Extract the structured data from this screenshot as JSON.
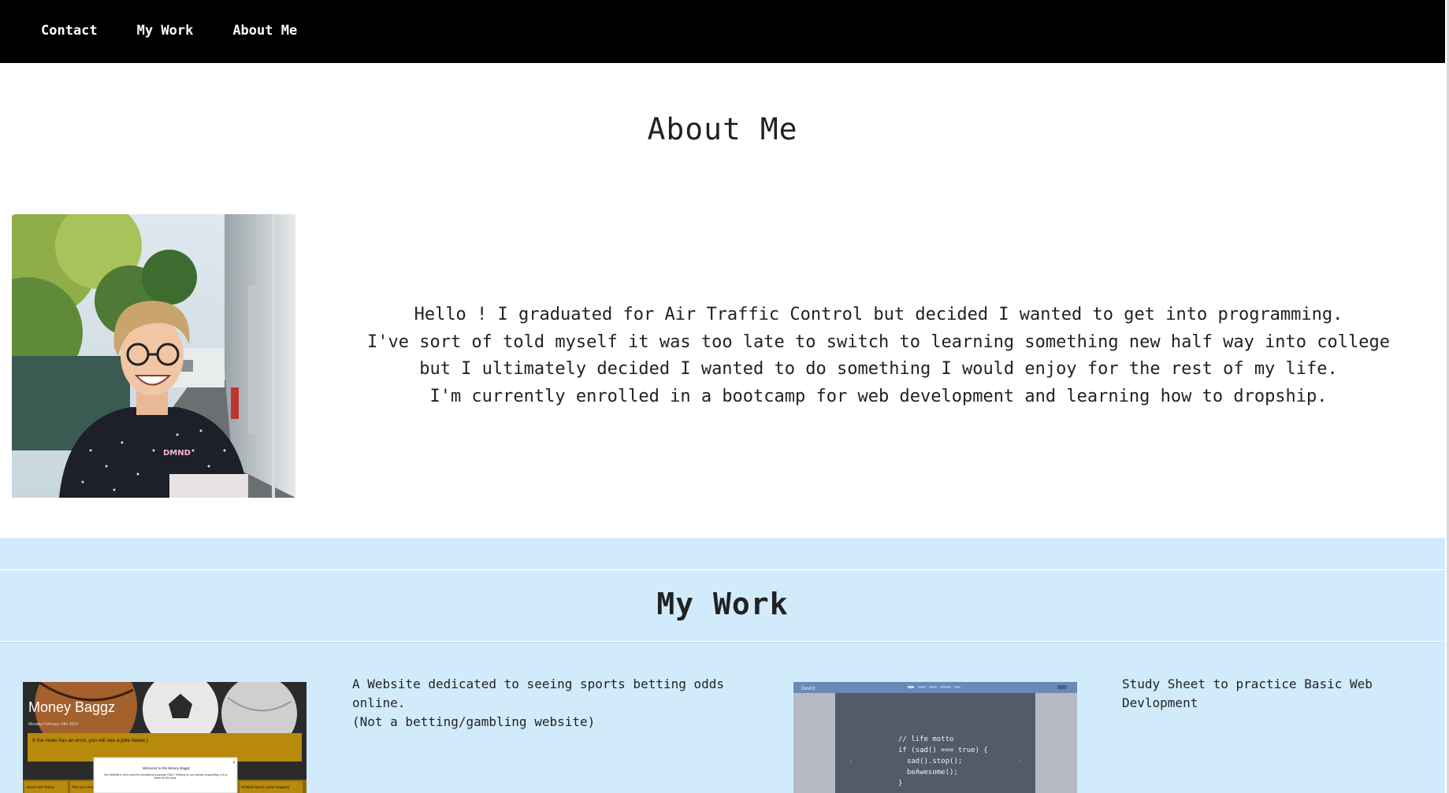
{
  "nav": {
    "items": [
      {
        "label": "Contact"
      },
      {
        "label": "My Work"
      },
      {
        "label": "About Me"
      }
    ]
  },
  "about": {
    "title": "About Me",
    "paragraphs": [
      "Hello ! I graduated for Air Traffic Control but decided I wanted to get into programming.",
      "I've sort of told myself it was too late to switch to learning something new half way into college but I ultimately decided I wanted to do something I would enjoy for the rest of my life.",
      "I'm currently enrolled in a bootcamp for web development and learning how to dropship."
    ],
    "shirt_logo": "DMND"
  },
  "work": {
    "title": "My Work",
    "projects": [
      {
        "description_line1": "A Website dedicated to seeing sports betting odds online.",
        "description_line2": "(Not a betting/gambling website)",
        "thumb": {
          "site_title": "Money Baggz",
          "date": "Monday February 14th 2023",
          "banner": "If the news has an error, you will see a joke below:)",
          "modal_title": "Welcome to the Money Baggz",
          "modal_body": "This Website is all to used for educational purposes ONLY. Nothing on our website is gambling, it is to show off the odds.",
          "tab1": "Sports and Teams",
          "tab2": "Pick your team",
          "tab3": "Related Sports (other leagues)"
        }
      },
      {
        "description_line1": "Study Sheet to practice Basic Web Devlopment",
        "thumb": {
          "brand": "DevKit",
          "code_line1": "// life motto",
          "code_line2": "if (sad() === true) {",
          "code_line3": "  sad().stop();",
          "code_line4": "  beAwesome();",
          "code_line5": "}"
        }
      }
    ]
  },
  "colors": {
    "nav_bg": "#000000",
    "work_bg": "#d1ebfb"
  }
}
